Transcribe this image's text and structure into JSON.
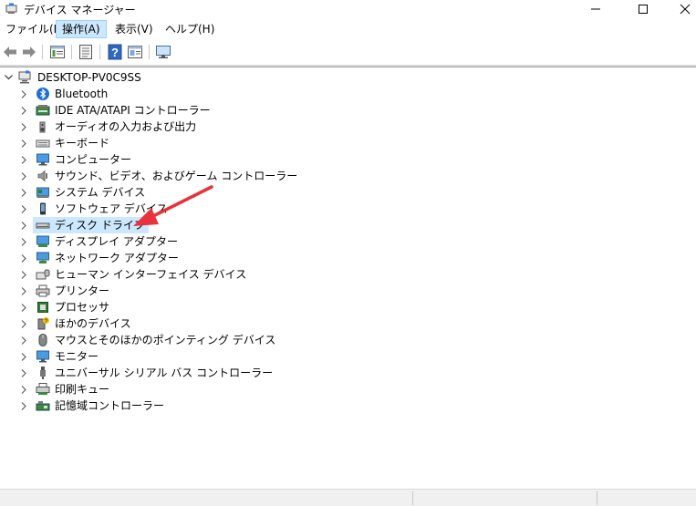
{
  "window": {
    "title": "デバイス マネージャー"
  },
  "menu": [
    {
      "label": "ファイル(F)",
      "active": false
    },
    {
      "label": "操作(A)",
      "active": true
    },
    {
      "label": "表示(V)",
      "active": false
    },
    {
      "label": "ヘルプ(H)",
      "active": false
    }
  ],
  "toolbar": {
    "icons": [
      "back-arrow-icon",
      "forward-arrow-icon",
      "properties-icon",
      "scan-icon",
      "help-icon",
      "view-icon",
      "monitor-icon"
    ]
  },
  "tree": {
    "root": {
      "label": "DESKTOP-PV0C9SS",
      "expanded": true
    },
    "items": [
      {
        "label": "Bluetooth",
        "icon": "bluetooth-icon"
      },
      {
        "label": "IDE ATA/ATAPI コントローラー",
        "icon": "ide-controller-icon"
      },
      {
        "label": "オーディオの入力および出力",
        "icon": "speaker-icon"
      },
      {
        "label": "キーボード",
        "icon": "keyboard-icon"
      },
      {
        "label": "コンピューター",
        "icon": "computer-icon"
      },
      {
        "label": "サウンド、ビデオ、およびゲーム コントローラー",
        "icon": "sound-icon"
      },
      {
        "label": "システム デバイス",
        "icon": "system-device-icon"
      },
      {
        "label": "ソフトウェア デバイス",
        "icon": "software-device-icon"
      },
      {
        "label": "ディスク ドライブ",
        "icon": "disk-drive-icon",
        "selected": true
      },
      {
        "label": "ディスプレイ アダプター",
        "icon": "display-adapter-icon"
      },
      {
        "label": "ネットワーク アダプター",
        "icon": "network-adapter-icon"
      },
      {
        "label": "ヒューマン インターフェイス デバイス",
        "icon": "hid-icon"
      },
      {
        "label": "プリンター",
        "icon": "printer-icon"
      },
      {
        "label": "プロセッサ",
        "icon": "processor-icon"
      },
      {
        "label": "ほかのデバイス",
        "icon": "other-device-icon"
      },
      {
        "label": "マウスとそのほかのポインティング デバイス",
        "icon": "mouse-icon"
      },
      {
        "label": "モニター",
        "icon": "monitor-icon"
      },
      {
        "label": "ユニバーサル シリアル バス コントローラー",
        "icon": "usb-icon"
      },
      {
        "label": "印刷キュー",
        "icon": "print-queue-icon"
      },
      {
        "label": "記憶域コントローラー",
        "icon": "storage-controller-icon"
      }
    ]
  },
  "colors": {
    "selection": "#cce8ff",
    "annotation_arrow": "#e8323c"
  }
}
